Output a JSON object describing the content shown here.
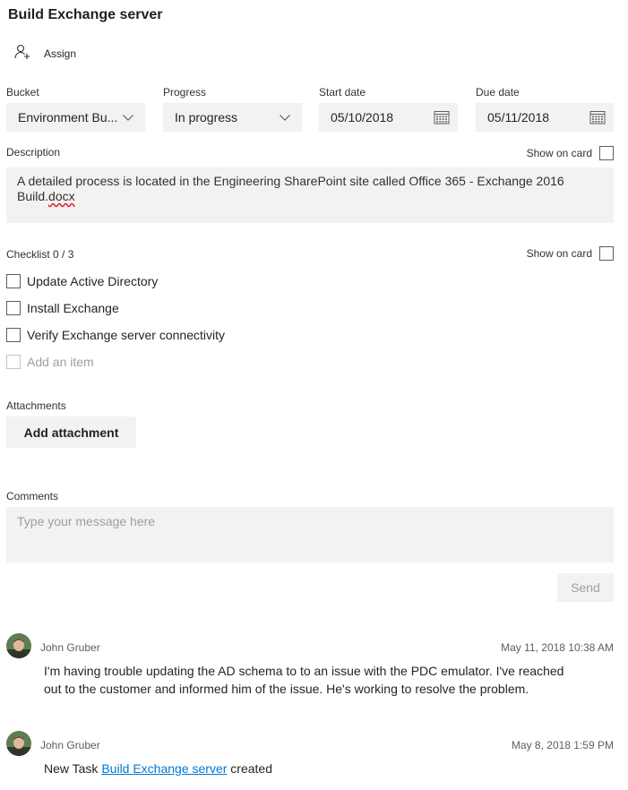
{
  "task": {
    "title": "Build Exchange server"
  },
  "assign": {
    "label": "Assign",
    "icon": "add-person-icon"
  },
  "fields": {
    "bucket": {
      "label": "Bucket",
      "value": "Environment Bu..."
    },
    "progress": {
      "label": "Progress",
      "value": "In progress"
    },
    "start_date": {
      "label": "Start date",
      "value": "05/10/2018"
    },
    "due_date": {
      "label": "Due date",
      "value": "05/11/2018"
    }
  },
  "description": {
    "label": "Description",
    "show_on_card": "Show on card",
    "text_main": "A detailed process is located in the Engineering SharePoint site called Office 365 - Exchange 2016 Build.",
    "text_misspelled": "docx"
  },
  "checklist": {
    "label": "Checklist 0 / 3",
    "show_on_card": "Show on card",
    "items": [
      {
        "label": "Update Active Directory",
        "checked": false
      },
      {
        "label": "Install Exchange",
        "checked": false
      },
      {
        "label": "Verify Exchange server connectivity",
        "checked": false
      }
    ],
    "add_placeholder": "Add an item"
  },
  "attachments": {
    "label": "Attachments",
    "button": "Add attachment"
  },
  "comments": {
    "label": "Comments",
    "placeholder": "Type your message here",
    "send": "Send",
    "items": [
      {
        "author": "John Gruber",
        "timestamp": "May 11, 2018 10:38 AM",
        "text": "I'm having trouble updating the AD schema to to an issue with the PDC emulator. I've reached out to the customer and informed him of the issue. He's working to resolve the problem."
      },
      {
        "author": "John Gruber",
        "timestamp": "May 8, 2018 1:59 PM",
        "text_prefix": "New Task ",
        "link": "Build Exchange server",
        "text_suffix": " created"
      }
    ]
  },
  "colors": {
    "accent": "#0078d4",
    "field_bg": "#f3f2f1",
    "muted_text": "#a19f9d"
  }
}
